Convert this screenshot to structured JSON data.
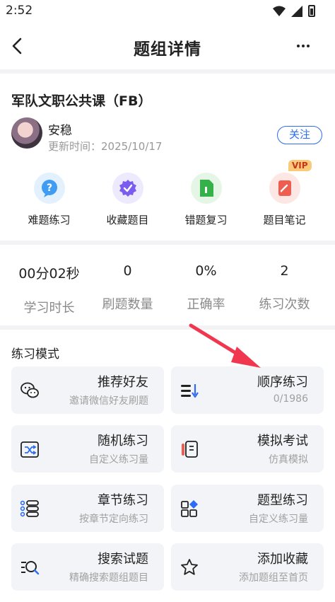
{
  "status": {
    "time": "2:52"
  },
  "nav": {
    "title": "题组详情"
  },
  "course": {
    "title": "军队文职公共课（FB）",
    "author": "安稳",
    "updated": "更新时间：2025/10/17",
    "follow_label": "关注"
  },
  "quick_actions": [
    {
      "label": "难题练习",
      "icon": "question-bubble-icon",
      "color": "#3f9cf2"
    },
    {
      "label": "收藏题目",
      "icon": "check-badge-icon",
      "color": "#7b5cf0"
    },
    {
      "label": "错题复习",
      "icon": "document-icon",
      "color": "#35b14a"
    },
    {
      "label": "题目笔记",
      "icon": "notebook-icon",
      "color": "#ee5d4f",
      "badge": "VIP"
    }
  ],
  "stats": [
    {
      "value": "00分02秒",
      "label": "学习时长"
    },
    {
      "value": "0",
      "label": "刷题数量"
    },
    {
      "value": "0%",
      "label": "正确率"
    },
    {
      "value": "2",
      "label": "练习次数"
    }
  ],
  "modes_title": "练习模式",
  "modes": [
    {
      "title": "推荐好友",
      "subtitle": "邀请微信好友刷题",
      "icon": "wechat-icon"
    },
    {
      "title": "顺序练习",
      "subtitle": "0/1986",
      "icon": "sequence-list-icon"
    },
    {
      "title": "随机练习",
      "subtitle": "自定义练习量",
      "icon": "shuffle-icon"
    },
    {
      "title": "模拟考试",
      "subtitle": "仿真模拟",
      "icon": "exam-pen-icon"
    },
    {
      "title": "章节练习",
      "subtitle": "按章节定向练习",
      "icon": "chapter-list-icon"
    },
    {
      "title": "题型练习",
      "subtitle": "自定义练习量",
      "icon": "question-type-icon"
    },
    {
      "title": "搜索试题",
      "subtitle": "精确搜索题组题目",
      "icon": "search-list-icon"
    },
    {
      "title": "添加收藏",
      "subtitle": "添加题组至首页",
      "icon": "star-icon"
    }
  ],
  "colors": {
    "accent": "#2d6df5",
    "arrow": "#f0374f"
  }
}
